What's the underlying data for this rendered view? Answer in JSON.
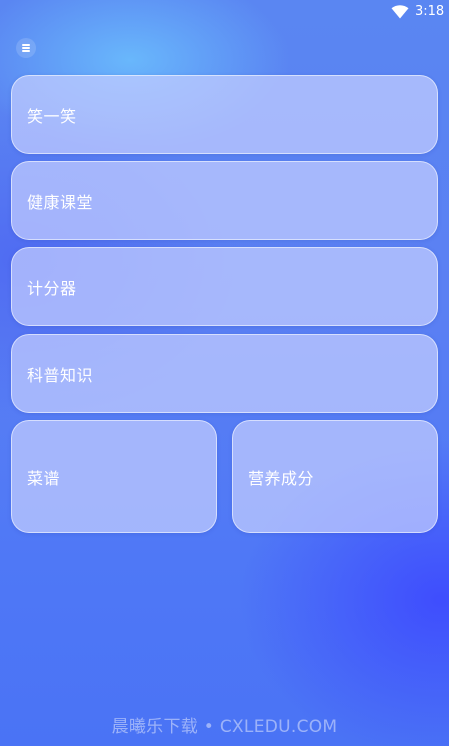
{
  "status_bar": {
    "time": "3:18",
    "wifi_icon": "wifi-icon"
  },
  "menu": {
    "icon": "menu-icon"
  },
  "cards": {
    "joke": "笑一笑",
    "health_class": "健康课堂",
    "scorer": "计分器",
    "science": "科普知识",
    "recipes": "菜谱",
    "nutrition": "营养成分"
  },
  "watermark": "晨曦乐下载 • CXLEDU.COM",
  "colors": {
    "background": "#5a80f3",
    "card": "#c4cdff"
  }
}
